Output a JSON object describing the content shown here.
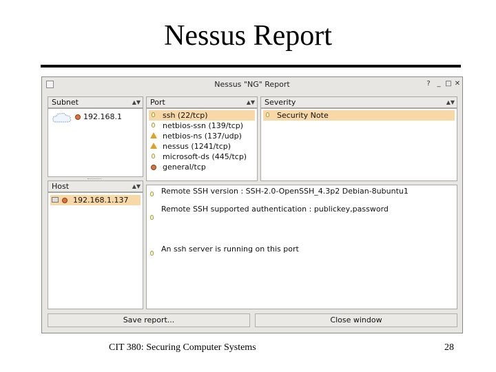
{
  "slide": {
    "title": "Nessus Report",
    "footer_left": "CIT 380: Securing Computer Systems",
    "page_number": "28"
  },
  "window": {
    "title": "Nessus \"NG\" Report",
    "buttons": [
      "?",
      "_",
      "□",
      "✕"
    ]
  },
  "subnet": {
    "header": "Subnet",
    "items": [
      {
        "label": "192.168.1",
        "icon": "danger-dot-icon",
        "selected": true
      }
    ]
  },
  "port": {
    "header": "Port",
    "items": [
      {
        "label": "ssh (22/tcp)",
        "icon": "note-bulb-icon",
        "selected": true
      },
      {
        "label": "netbios-ssn (139/tcp)",
        "icon": "note-bulb-icon",
        "selected": false
      },
      {
        "label": "netbios-ns (137/udp)",
        "icon": "warning-icon",
        "selected": false
      },
      {
        "label": "nessus (1241/tcp)",
        "icon": "warning-icon",
        "selected": false
      },
      {
        "label": "microsoft-ds (445/tcp)",
        "icon": "note-bulb-icon",
        "selected": false
      },
      {
        "label": "general/tcp",
        "icon": "danger-dot-icon",
        "selected": false
      }
    ]
  },
  "severity": {
    "header": "Severity",
    "items": [
      {
        "label": "Security Note",
        "icon": "note-bulb-icon",
        "selected": true
      }
    ]
  },
  "host": {
    "header": "Host",
    "items": [
      {
        "label": "192.168.1.137",
        "icon": "danger-dot-icon",
        "selected": true
      }
    ]
  },
  "report": {
    "lines": [
      "Remote SSH version : SSH-2.0-OpenSSH_4.3p2 Debian-8ubuntu1",
      "Remote SSH supported authentication : publickey,password",
      "An ssh server is running on this port"
    ]
  },
  "actions": {
    "save_label": "Save report...",
    "close_label": "Close window"
  },
  "colors": {
    "selection": "#f7d8a6",
    "warning": "#e3a028",
    "danger": "#d9743d"
  }
}
